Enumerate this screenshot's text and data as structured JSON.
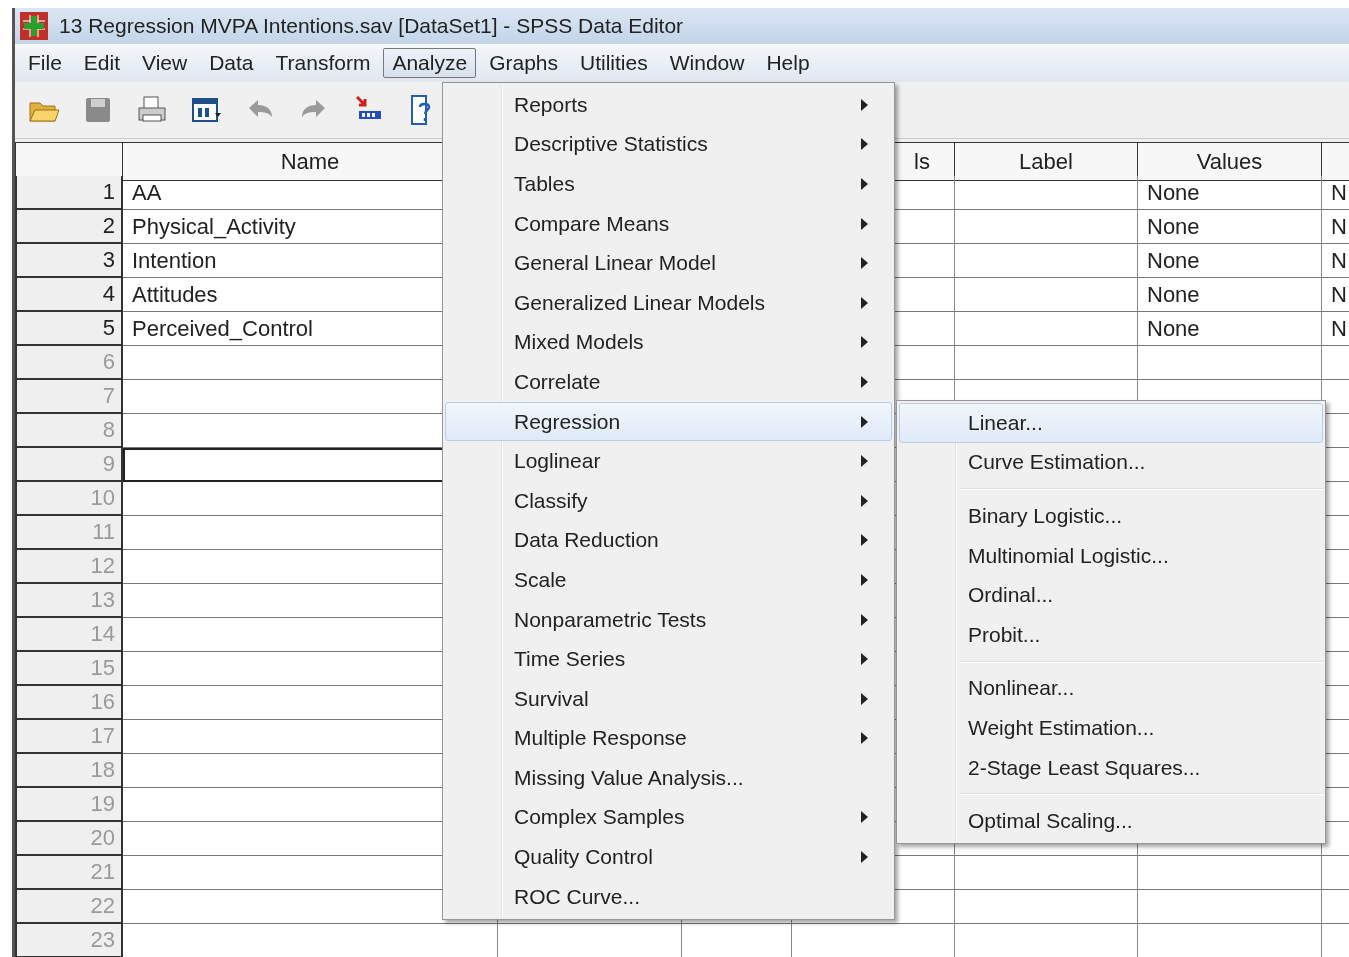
{
  "window": {
    "title": "13 Regression MVPA Intentions.sav [DataSet1] - SPSS Data Editor"
  },
  "menu_bar": [
    {
      "label": "File",
      "selected": false
    },
    {
      "label": "Edit",
      "selected": false
    },
    {
      "label": "View",
      "selected": false
    },
    {
      "label": "Data",
      "selected": false
    },
    {
      "label": "Transform",
      "selected": false
    },
    {
      "label": "Analyze",
      "selected": true
    },
    {
      "label": "Graphs",
      "selected": false
    },
    {
      "label": "Utilities",
      "selected": false
    },
    {
      "label": "Window",
      "selected": false
    },
    {
      "label": "Help",
      "selected": false
    }
  ],
  "table": {
    "columns": [
      "Name",
      null,
      null,
      "ls",
      "Label",
      "Values",
      null
    ],
    "rows": [
      {
        "number": "1",
        "name": "AA",
        "values": "None",
        "column_7": "N",
        "selected": false
      },
      {
        "number": "2",
        "name": "Physical_Activity",
        "values": "None",
        "column_7": "N",
        "selected": false
      },
      {
        "number": "3",
        "name": "Intention",
        "values": "None",
        "column_7": "N",
        "selected": false
      },
      {
        "number": "4",
        "name": "Attitudes",
        "values": "None",
        "column_7": "N",
        "selected": false
      },
      {
        "number": "5",
        "name": "Perceived_Control",
        "values": "None",
        "column_7": "N",
        "selected": false
      },
      {
        "number": "6",
        "selected": false
      },
      {
        "number": "7",
        "selected": false
      },
      {
        "number": "8",
        "selected": false
      },
      {
        "number": "9",
        "selected": true
      },
      {
        "number": "10",
        "selected": false
      },
      {
        "number": "11",
        "selected": false
      },
      {
        "number": "12",
        "selected": false
      },
      {
        "number": "13",
        "selected": false
      },
      {
        "number": "14",
        "selected": false
      },
      {
        "number": "15",
        "selected": false
      },
      {
        "number": "16",
        "selected": false
      },
      {
        "number": "17",
        "selected": false
      },
      {
        "number": "18",
        "selected": false
      },
      {
        "number": "19",
        "selected": false
      },
      {
        "number": "20",
        "selected": false
      },
      {
        "number": "21",
        "selected": false
      },
      {
        "number": "22",
        "selected": false
      },
      {
        "number": "23",
        "selected": false
      }
    ]
  },
  "analyze_menu": [
    {
      "label": "Reports",
      "submenu": true,
      "selected": false
    },
    {
      "label": "Descriptive Statistics",
      "submenu": true,
      "selected": false
    },
    {
      "label": "Tables",
      "submenu": true,
      "selected": false
    },
    {
      "label": "Compare Means",
      "submenu": true,
      "selected": false
    },
    {
      "label": "General Linear Model",
      "submenu": true,
      "selected": false
    },
    {
      "label": "Generalized Linear Models",
      "submenu": true,
      "selected": false
    },
    {
      "label": "Mixed Models",
      "submenu": true,
      "selected": false
    },
    {
      "label": "Correlate",
      "submenu": true,
      "selected": false
    },
    {
      "label": "Regression",
      "submenu": true,
      "selected": true
    },
    {
      "label": "Loglinear",
      "submenu": true,
      "selected": false
    },
    {
      "label": "Classify",
      "submenu": true,
      "selected": false
    },
    {
      "label": "Data Reduction",
      "submenu": true,
      "selected": false
    },
    {
      "label": "Scale",
      "submenu": true,
      "selected": false
    },
    {
      "label": "Nonparametric Tests",
      "submenu": true,
      "selected": false
    },
    {
      "label": "Time Series",
      "submenu": true,
      "selected": false
    },
    {
      "label": "Survival",
      "submenu": true,
      "selected": false
    },
    {
      "label": "Multiple Response",
      "submenu": true,
      "selected": false
    },
    {
      "label": "Missing Value Analysis...",
      "submenu": false,
      "selected": false
    },
    {
      "label": "Complex Samples",
      "submenu": true,
      "selected": false
    },
    {
      "label": "Quality Control",
      "submenu": true,
      "selected": false
    },
    {
      "label": "ROC Curve...",
      "submenu": false,
      "selected": false
    }
  ],
  "regression_submenu": [
    {
      "kind": "item",
      "label": "Linear...",
      "selected": true
    },
    {
      "kind": "item",
      "label": "Curve Estimation...",
      "selected": false
    },
    {
      "kind": "separator"
    },
    {
      "kind": "item",
      "label": "Binary Logistic...",
      "selected": false
    },
    {
      "kind": "item",
      "label": "Multinomial Logistic...",
      "selected": false
    },
    {
      "kind": "item",
      "label": "Ordinal...",
      "selected": false
    },
    {
      "kind": "item",
      "label": "Probit...",
      "selected": false
    },
    {
      "kind": "separator"
    },
    {
      "kind": "item",
      "label": "Nonlinear...",
      "selected": false
    },
    {
      "kind": "item",
      "label": "Weight Estimation...",
      "selected": false
    },
    {
      "kind": "item",
      "label": "2-Stage Least Squares...",
      "selected": false
    },
    {
      "kind": "separator"
    },
    {
      "kind": "item",
      "label": "Optimal Scaling...",
      "selected": false
    }
  ]
}
